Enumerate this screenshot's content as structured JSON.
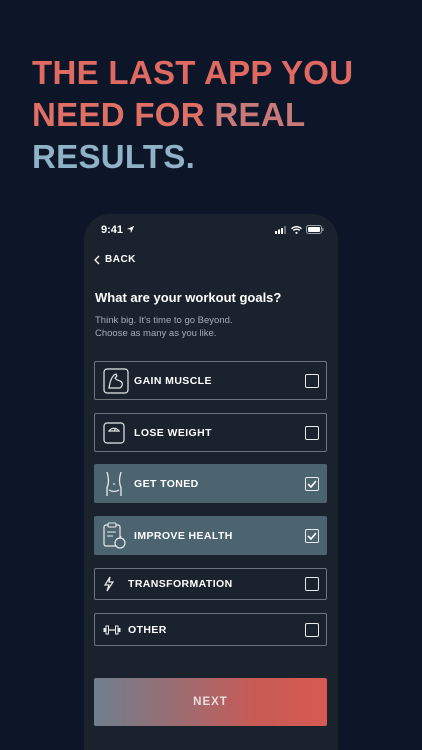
{
  "headline": {
    "line1": "THE LAST APP YOU",
    "line2_word1": "NEED FOR",
    "line2_word2": "REAL",
    "line3": "RESULTS."
  },
  "status_bar": {
    "time": "9:41"
  },
  "nav": {
    "back_label": "BACK"
  },
  "screen": {
    "title": "What are your workout goals?",
    "subtitle_line1": "Think big. It's time to go Beyond.",
    "subtitle_line2": "Choose as many as you like."
  },
  "options": [
    {
      "label": "GAIN MUSCLE",
      "icon": "flexed-arm-icon",
      "checked": false
    },
    {
      "label": "LOSE WEIGHT",
      "icon": "scale-icon",
      "checked": false
    },
    {
      "label": "GET TONED",
      "icon": "torso-icon",
      "checked": true
    },
    {
      "label": "IMPROVE HEALTH",
      "icon": "clipboard-apple-icon",
      "checked": true
    },
    {
      "label": "TRANSFORMATION",
      "icon": "lightning-icon",
      "checked": false
    },
    {
      "label": "OTHER",
      "icon": "dumbbell-icon",
      "checked": false
    }
  ],
  "next_button": {
    "label": "NEXT"
  },
  "colors": {
    "background": "#0d1628",
    "phone_background": "#1a222e",
    "selected_option": "#4c6470",
    "accent_red": "#e06a62",
    "accent_blue": "#8fb2c6"
  }
}
